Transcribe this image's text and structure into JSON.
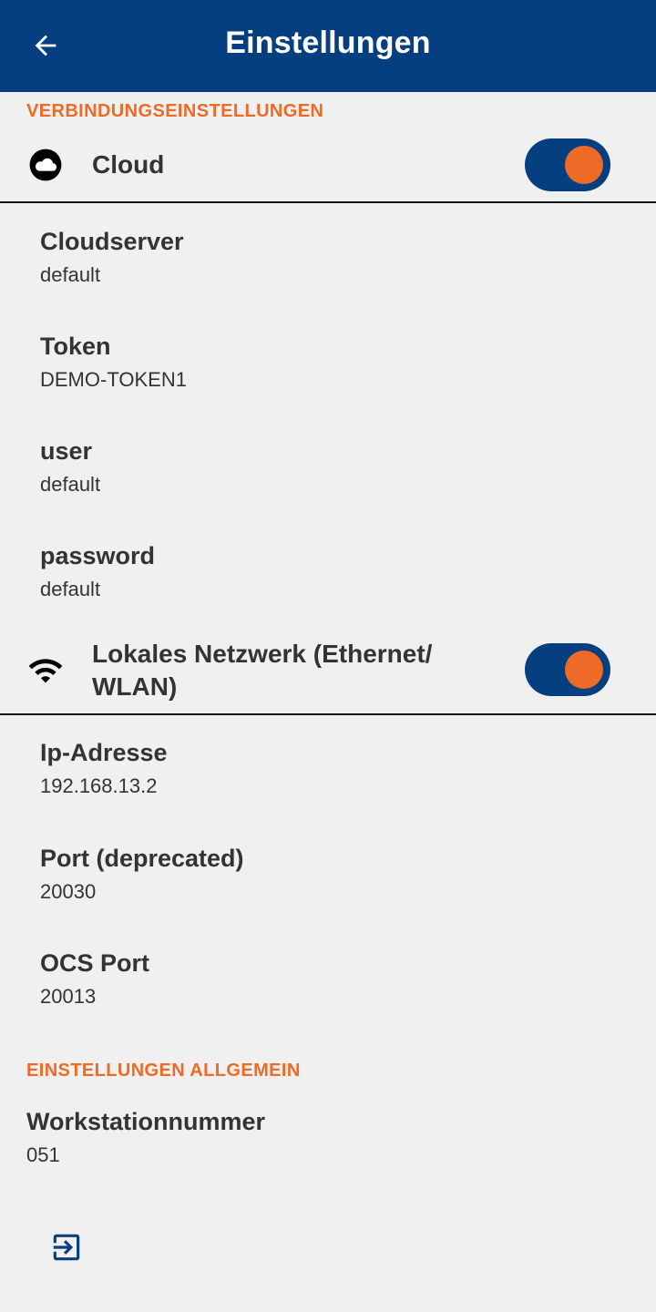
{
  "colors": {
    "appbar": "#063f7f",
    "accent_orange": "#ee6a26",
    "background": "#f0f0f0",
    "text": "#333333",
    "toggle_track": "#063f7f"
  },
  "appbar": {
    "title": "Einstellungen",
    "back_icon": "arrow-left-icon"
  },
  "connection": {
    "header": "VERBINDUNGSEINSTELLUNGEN",
    "cloud": {
      "icon": "cloud-icon",
      "label": "Cloud",
      "enabled": true,
      "settings": [
        {
          "title": "Cloudserver",
          "value": "default"
        },
        {
          "title": "Token",
          "value": "DEMO-TOKEN1"
        },
        {
          "title": "user",
          "value": "default"
        },
        {
          "title": "password",
          "value": "default"
        }
      ]
    },
    "local": {
      "icon": "wifi-icon",
      "label_line1": "Lokales Netzwerk (Ethernet/",
      "label_line2": "WLAN)",
      "enabled": true,
      "settings": [
        {
          "title": "Ip-Adresse",
          "value": "192.168.13.2"
        },
        {
          "title": "Port (deprecated)",
          "value": "20030"
        },
        {
          "title": "OCS Port",
          "value": "20013"
        }
      ]
    }
  },
  "general": {
    "header": "EINSTELLUNGEN ALLGEMEIN",
    "settings": [
      {
        "title": "Workstationnummer",
        "value": "051"
      }
    ]
  },
  "footer": {
    "exit_icon": "logout-icon"
  }
}
